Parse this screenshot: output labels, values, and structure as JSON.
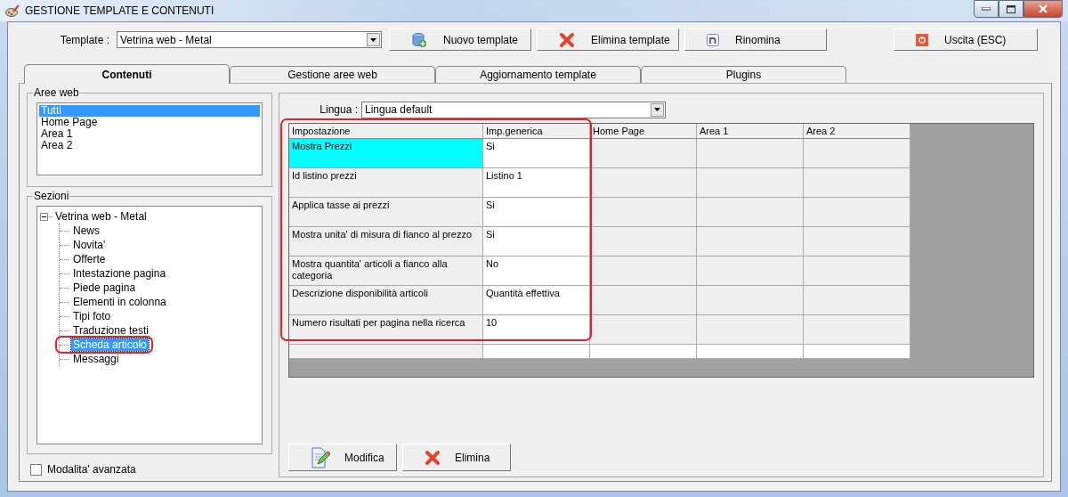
{
  "window": {
    "title": "GESTIONE TEMPLATE E CONTENUTI"
  },
  "template": {
    "label": "Template :",
    "value": "Vetrina web - Metal"
  },
  "toolbar": [
    {
      "label": "Nuovo template",
      "kind": "add"
    },
    {
      "label": "Elimina template",
      "kind": "delete"
    },
    {
      "label": "Rinomina",
      "kind": "rename"
    },
    {
      "label": "Uscita (ESC)",
      "kind": "exit"
    }
  ],
  "tabs": [
    {
      "label": "Contenuti",
      "selected": true
    },
    {
      "label": "Gestione aree web",
      "selected": false
    },
    {
      "label": "Aggiornamento template",
      "selected": false
    },
    {
      "label": "Plugins",
      "selected": false
    }
  ],
  "aree_web": {
    "title": "Aree web",
    "items": [
      {
        "label": "Tutti",
        "selected": true
      },
      {
        "label": "Home Page",
        "selected": false
      },
      {
        "label": "Area 1",
        "selected": false
      },
      {
        "label": "Area 2",
        "selected": false
      }
    ]
  },
  "sezioni": {
    "title": "Sezioni",
    "tree": {
      "label": "Vetrina web - Metal",
      "expanded": true,
      "children": [
        {
          "label": "News",
          "selected": false
        },
        {
          "label": "Novita'",
          "selected": false
        },
        {
          "label": "Offerte",
          "selected": false
        },
        {
          "label": "Intestazione pagina",
          "selected": false
        },
        {
          "label": "Piede pagina",
          "selected": false
        },
        {
          "label": "Elementi in colonna",
          "selected": false
        },
        {
          "label": "Tipi foto",
          "selected": false
        },
        {
          "label": "Traduzione testi",
          "selected": false
        },
        {
          "label": "Scheda articolo",
          "selected": true
        },
        {
          "label": "Messaggi",
          "selected": false
        }
      ]
    }
  },
  "advanced_mode": {
    "label": "Modalita' avanzata",
    "checked": false
  },
  "lingua": {
    "label": "Lingua :",
    "value": "Lingua default"
  },
  "table": {
    "columns": [
      "Impostazione",
      "Imp.generica",
      "Home Page",
      "Area 1",
      "Area 2"
    ],
    "rows": [
      {
        "setting": "Mostra Prezzi",
        "generic": "Si",
        "selected": true
      },
      {
        "setting": "Id listino prezzi",
        "generic": "Listino 1",
        "selected": false
      },
      {
        "setting": "Applica tasse ai prezzi",
        "generic": "Si",
        "selected": false
      },
      {
        "setting": "Mostra unita' di misura di fianco al prezzo",
        "generic": "Si",
        "selected": false
      },
      {
        "setting": "Mostra quantita' articoli a fianco alla categoria",
        "generic": "No",
        "selected": false
      },
      {
        "setting": "Descrizione disponibilità articoli",
        "generic": "Quantità effettiva",
        "selected": false
      },
      {
        "setting": "Numero risultati per pagina nella ricerca",
        "generic": "10",
        "selected": false
      }
    ]
  },
  "actions": [
    {
      "label": "Modifica",
      "kind": "edit"
    },
    {
      "label": "Elimina",
      "kind": "delete"
    }
  ]
}
